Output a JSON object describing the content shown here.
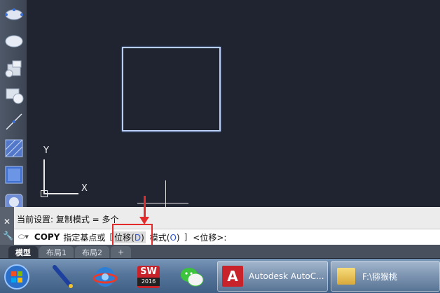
{
  "tools": [
    {
      "name": "ellipse-arc-icon"
    },
    {
      "name": "ellipse-icon"
    },
    {
      "name": "insert-block-icon"
    },
    {
      "name": "make-block-icon"
    },
    {
      "name": "line-icon"
    },
    {
      "name": "hatch-icon"
    },
    {
      "name": "gradient-icon"
    },
    {
      "name": "region-icon"
    }
  ],
  "ucs": {
    "y_label": "Y",
    "x_label": "X"
  },
  "command": {
    "history": "当前设置:   复制模式 = 多个",
    "name": "COPY",
    "prompt": "指定基点或",
    "bracket_open": "[",
    "option1_text": "位移",
    "option1_key": "D",
    "option2_text": "模式",
    "option2_key": "O",
    "bracket_close": "]",
    "default": "<位移>:"
  },
  "tabs": [
    {
      "label": "模型",
      "active": true
    },
    {
      "label": "布局1",
      "active": false
    },
    {
      "label": "布局2",
      "active": false
    },
    {
      "label": "+",
      "active": false
    }
  ],
  "taskbar": {
    "autocad_label": "Autodesk AutoC...",
    "folder_label": "F:\\猕猴桃",
    "sw_label": "SW",
    "sw_year": "2016"
  }
}
